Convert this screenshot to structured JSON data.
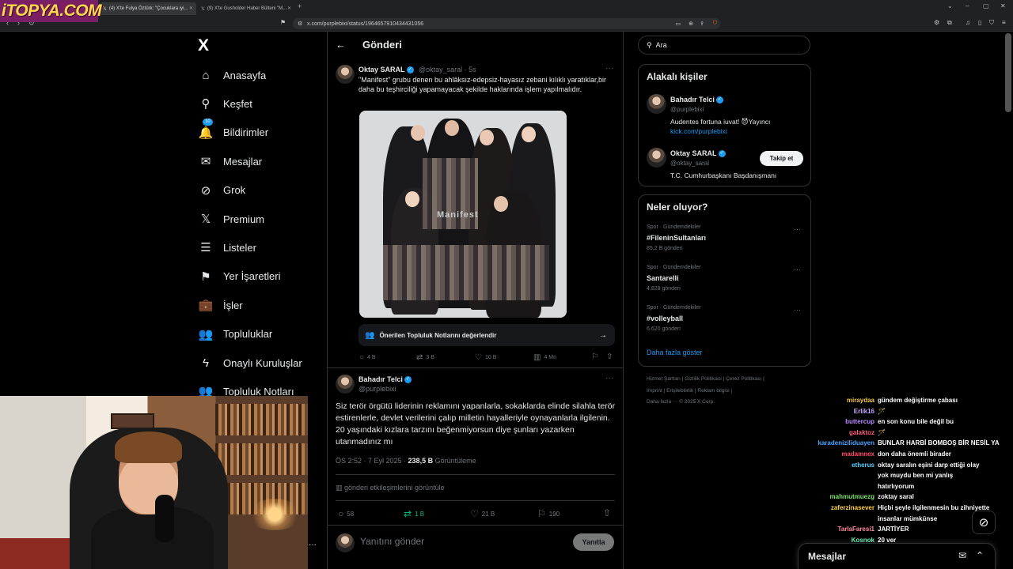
{
  "browser": {
    "tabs": [
      {
        "label": "(4) X'te Fulya Öztürk: \"Çocuklara iyi...",
        "close": "✕"
      },
      {
        "label": "(9) X'te Gusholder Haber Bülteni \"M...",
        "close": "✕"
      }
    ],
    "url": "x.com/purplebixi/status/1964657910434431056",
    "new_tab": "+"
  },
  "overlay_logo": "iTOPYA.COM",
  "nav": {
    "logo": "X",
    "items": [
      {
        "label": "Anasayfa",
        "icon": "home-icon",
        "glyph": "⌂"
      },
      {
        "label": "Keşfet",
        "icon": "search-icon",
        "glyph": "⚲"
      },
      {
        "label": "Bildirimler",
        "icon": "bell-icon",
        "glyph": "🔔",
        "badge": "10"
      },
      {
        "label": "Mesajlar",
        "icon": "mail-icon",
        "glyph": "✉"
      },
      {
        "label": "Grok",
        "icon": "grok-icon",
        "glyph": "⊘"
      },
      {
        "label": "Premium",
        "icon": "x-premium-icon",
        "glyph": "𝕏"
      },
      {
        "label": "Listeler",
        "icon": "list-icon",
        "glyph": "☰"
      },
      {
        "label": "Yer İşaretleri",
        "icon": "bookmark-icon",
        "glyph": "⚑"
      },
      {
        "label": "İşler",
        "icon": "briefcase-icon",
        "glyph": "💼"
      },
      {
        "label": "Topluluklar",
        "icon": "communities-icon",
        "glyph": "👥"
      },
      {
        "label": "Onaylı Kuruluşlar",
        "icon": "lightning-icon",
        "glyph": "ϟ"
      },
      {
        "label": "Topluluk Notları",
        "icon": "community-notes-icon",
        "glyph": "👥"
      }
    ]
  },
  "header": {
    "back": "←",
    "title": "Gönderi"
  },
  "quoted": {
    "name": "Oktay SARAL",
    "handle": "@oktay_saral · 5s",
    "text": "\"Manifest\" grubu denen bu ahlâksız-edepsiz-hayasız zebani kılıklı yaratıklar,bir daha bu teşhirciliği yapamayacak şekilde haklarında işlem yapılmalıdır.",
    "note": "Önerilen Topluluk Notlarını değerlendir",
    "watermark": "Manifest",
    "actions": {
      "reply": "4 B",
      "retweet": "3 B",
      "like": "10 B",
      "views": "4 Mn"
    }
  },
  "post": {
    "name": "Bahadır Telci",
    "handle": "@purplebixi",
    "text": "Siz terör örgütü liderinin reklamını yapanlarla, sokaklarda elinde silahla terör estirenlerle, devlet verilerini çalıp milletin hayalleriyle oynayanlarla ilgilenin. 20 yaşındaki kızlara tarzını beğenmiyorsun diye şunları yazarken utanmadınız mı",
    "time": "ÖS 2:52 · 7 Eyl 2025 · ",
    "views": "238,5 B",
    "views_label": " Görüntüleme",
    "engagements": "gönderi etkileşimlerini görüntüle",
    "actions": {
      "reply": "58",
      "retweet": "1 B",
      "like": "21 B",
      "bookmark": "190"
    },
    "reply_placeholder": "Yanıtını gönder",
    "reply_button": "Yanıtla"
  },
  "sidebar": {
    "search_placeholder": "Ara",
    "related_title": "Alakalı kişiler",
    "people": [
      {
        "name": "Bahadır Telci",
        "handle": "@purplebixi",
        "bio": "Audentes fortuna iuvat! 😈Yayıncı",
        "link": "kick.com/purplebixi"
      },
      {
        "name": "Oktay SARAL",
        "handle": "@oktay_saral",
        "bio": "T.C. Cumhurbaşkanı Başdanışmanı",
        "follow": "Takip et"
      }
    ],
    "trends_title": "Neler oluyor?",
    "trends": [
      {
        "category": "Spor · Gündemdekiler",
        "tag": "#FileninSultanları",
        "count": "85,2 B gönderi"
      },
      {
        "category": "Spor · Gündemdekiler",
        "tag": "Santarelli",
        "count": "4.828 gönderi"
      },
      {
        "category": "Spor · Gündemdekiler",
        "tag": "#volleyball",
        "count": "6.620 gönderi"
      }
    ],
    "show_more": "Daha fazla göster",
    "footer1": "Hizmet Şartları  |  Gizlilik Politikası  |  Çerez Politikası  |",
    "footer2": "Imprint  |  Erişilebilirlik  |  Reklam bilgisi  |",
    "footer3": "Daha fazla ···   © 2025 X Corp."
  },
  "chat": [
    {
      "user": "miraydaa",
      "color": "#f2c94c",
      "msg": "gündem değiştirme çabası"
    },
    {
      "user": "Erlik16",
      "color": "#c6a3ff",
      "msg": "🪄"
    },
    {
      "user": "buttercup",
      "color": "#b98cff",
      "msg": "en son konu bile değil bu"
    },
    {
      "user": "galaktoz",
      "color": "#ff5a7a",
      "msg": "🪄"
    },
    {
      "user": "karadeniziliduayen",
      "color": "#4aa3ff",
      "msg": "BUNLAR HARBİ BOMBOŞ BİR NESİL YA"
    },
    {
      "user": "madamnex",
      "color": "#ff4d6d",
      "msg": "don daha önemli birader"
    },
    {
      "user": "etherus",
      "color": "#5ad0ff",
      "msg": "oktay saralın eşini darp ettiği olay"
    },
    {
      "user": "",
      "color": "#ffffff",
      "msg": "yok muydu ben mi yanlış"
    },
    {
      "user": "",
      "color": "#ffffff",
      "msg": "hatırlıyorum"
    },
    {
      "user": "mahmutmuezg",
      "color": "#7ee36b",
      "msg": "zoktay saral"
    },
    {
      "user": "zaferzinasever",
      "color": "#ffd24a",
      "msg": "Hiçbi şeyle ilgilenmesin bu zihniyette"
    },
    {
      "user": "",
      "color": "#ffffff",
      "msg": "insanlar mümkünse"
    },
    {
      "user": "TarlaFaresi1",
      "color": "#ff8aa0",
      "msg": "JARTİYER"
    },
    {
      "user": "Kosnok",
      "color": "#5af0b0",
      "msg": "20 ver"
    }
  ],
  "dm": {
    "title": "Mesajlar"
  }
}
